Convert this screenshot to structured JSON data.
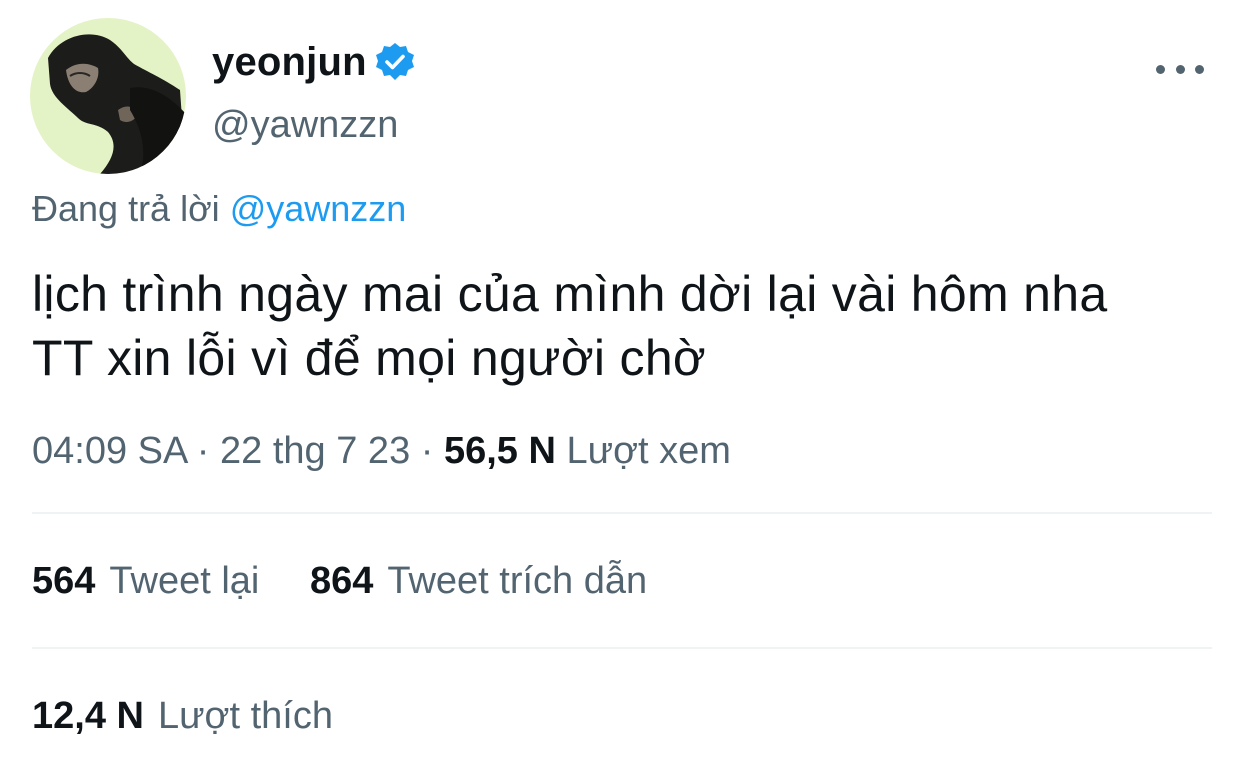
{
  "author": {
    "display_name": "yeonjun",
    "handle": "@yawnzzn",
    "verified": true
  },
  "reply": {
    "prefix": "Đang trả lời",
    "handle": "@yawnzzn"
  },
  "tweet": {
    "lines": [
      "lịch trình ngày mai của mình dời lại vài hôm nha",
      "TT xin lỗi vì để mọi người chờ"
    ]
  },
  "meta": {
    "time": "04:09 SA",
    "sep1": " · ",
    "date": "22 thg 7 23",
    "sep2": " · ",
    "views_count": "56,5 N",
    "views_label": "Lượt xem"
  },
  "stats": {
    "retweets_count": "564",
    "retweets_label": "Tweet lại",
    "quotes_count": "864",
    "quotes_label": "Tweet trích dẫn",
    "likes_count": "12,4 N",
    "likes_label": "Lượt thích"
  },
  "icons": {
    "verified": "verified-badge-icon",
    "more": "more-horizontal-icon"
  },
  "colors": {
    "accent": "#1d9bf0",
    "text_primary": "#0f1419",
    "text_secondary": "#536471",
    "divider": "#eff3f4",
    "avatar_bg": "#e4f3c6"
  }
}
